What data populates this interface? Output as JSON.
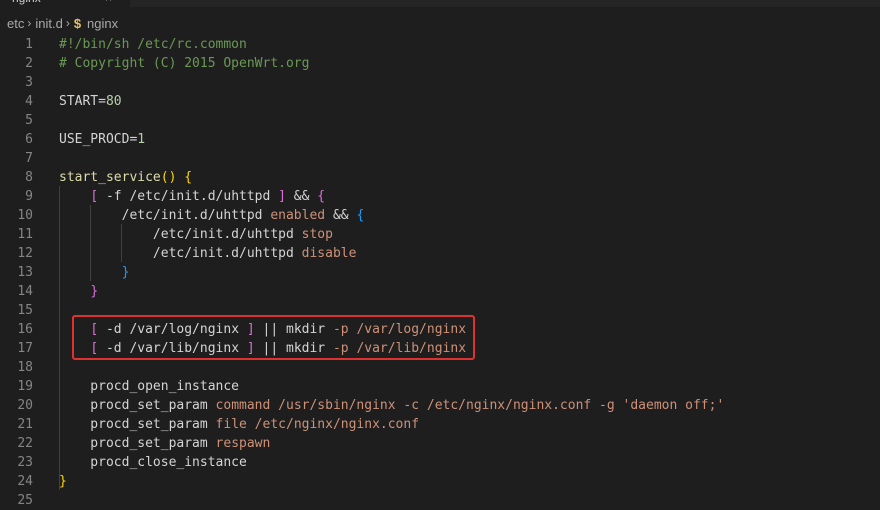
{
  "tab": {
    "label": "nginx",
    "close": "×"
  },
  "breadcrumb": {
    "parts": [
      "etc",
      "init.d"
    ],
    "separator": "›",
    "file_icon": "$",
    "file": "nginx"
  },
  "lines": [
    {
      "n": "1",
      "tokens": [
        {
          "t": "#!/bin/sh /etc/rc.common",
          "c": "cm"
        }
      ]
    },
    {
      "n": "2",
      "tokens": [
        {
          "t": "# Copyright (C) 2015 OpenWrt.org",
          "c": "cm"
        }
      ]
    },
    {
      "n": "3",
      "tokens": []
    },
    {
      "n": "4",
      "tokens": [
        {
          "t": "START=",
          "c": "pl"
        },
        {
          "t": "80",
          "c": "nm"
        }
      ]
    },
    {
      "n": "5",
      "tokens": []
    },
    {
      "n": "6",
      "tokens": [
        {
          "t": "USE_PROCD=",
          "c": "pl"
        },
        {
          "t": "1",
          "c": "nm"
        }
      ]
    },
    {
      "n": "7",
      "tokens": []
    },
    {
      "n": "8",
      "tokens": [
        {
          "t": "start_service",
          "c": "fn"
        },
        {
          "t": "() ",
          "c": "b1"
        },
        {
          "t": "{",
          "c": "b1"
        }
      ]
    },
    {
      "n": "9",
      "tokens": [
        {
          "t": "    ",
          "c": "pl"
        },
        {
          "t": "[",
          "c": "b2"
        },
        {
          "t": " -f /etc/init.d/uhttpd ",
          "c": "pl"
        },
        {
          "t": "]",
          "c": "b2"
        },
        {
          "t": " && ",
          "c": "pl"
        },
        {
          "t": "{",
          "c": "b2"
        }
      ]
    },
    {
      "n": "10",
      "tokens": [
        {
          "t": "        /etc/init.d/uhttpd ",
          "c": "pl"
        },
        {
          "t": "enabled",
          "c": "st"
        },
        {
          "t": " && ",
          "c": "pl"
        },
        {
          "t": "{",
          "c": "b3"
        }
      ]
    },
    {
      "n": "11",
      "tokens": [
        {
          "t": "            /etc/init.d/uhttpd ",
          "c": "pl"
        },
        {
          "t": "stop",
          "c": "st"
        }
      ]
    },
    {
      "n": "12",
      "tokens": [
        {
          "t": "            /etc/init.d/uhttpd ",
          "c": "pl"
        },
        {
          "t": "disable",
          "c": "st"
        }
      ]
    },
    {
      "n": "13",
      "tokens": [
        {
          "t": "        ",
          "c": "pl"
        },
        {
          "t": "}",
          "c": "b3"
        }
      ]
    },
    {
      "n": "14",
      "tokens": [
        {
          "t": "    ",
          "c": "pl"
        },
        {
          "t": "}",
          "c": "b2"
        }
      ]
    },
    {
      "n": "15",
      "tokens": []
    },
    {
      "n": "16",
      "tokens": [
        {
          "t": "    ",
          "c": "pl"
        },
        {
          "t": "[",
          "c": "b2"
        },
        {
          "t": " -d /var/log/nginx ",
          "c": "pl"
        },
        {
          "t": "]",
          "c": "b2"
        },
        {
          "t": " || mkdir ",
          "c": "pl"
        },
        {
          "t": "-p /var/log/nginx",
          "c": "st"
        }
      ]
    },
    {
      "n": "17",
      "tokens": [
        {
          "t": "    ",
          "c": "pl"
        },
        {
          "t": "[",
          "c": "b2"
        },
        {
          "t": " -d /var/lib/nginx ",
          "c": "pl"
        },
        {
          "t": "]",
          "c": "b2"
        },
        {
          "t": " || mkdir ",
          "c": "pl"
        },
        {
          "t": "-p /var/lib/nginx",
          "c": "st"
        }
      ]
    },
    {
      "n": "18",
      "tokens": []
    },
    {
      "n": "19",
      "tokens": [
        {
          "t": "    procd_open_instance",
          "c": "pl"
        }
      ]
    },
    {
      "n": "20",
      "tokens": [
        {
          "t": "    procd_set_param ",
          "c": "pl"
        },
        {
          "t": "command /usr/sbin/nginx -c /etc/nginx/nginx.conf -g 'daemon off;'",
          "c": "st"
        }
      ]
    },
    {
      "n": "21",
      "tokens": [
        {
          "t": "    procd_set_param ",
          "c": "pl"
        },
        {
          "t": "file /etc/nginx/nginx.conf",
          "c": "st"
        }
      ]
    },
    {
      "n": "22",
      "tokens": [
        {
          "t": "    procd_set_param ",
          "c": "pl"
        },
        {
          "t": "respawn",
          "c": "st"
        }
      ]
    },
    {
      "n": "23",
      "tokens": [
        {
          "t": "    procd_close_instance",
          "c": "pl"
        }
      ]
    },
    {
      "n": "24",
      "tokens": [
        {
          "t": "}",
          "c": "b1"
        }
      ]
    },
    {
      "n": "25",
      "tokens": []
    }
  ],
  "theme": {
    "background": "#1e1e1e",
    "comment": "#6a9955",
    "number": "#b5cea8",
    "function": "#dcdcaa",
    "string": "#ce9178",
    "highlight_box": "#e03131"
  }
}
